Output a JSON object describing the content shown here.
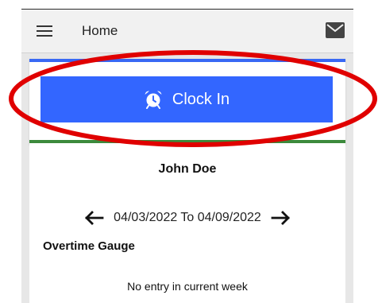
{
  "header": {
    "title": "Home",
    "menu_icon": "menu-icon",
    "mail_icon": "mail-icon"
  },
  "clock": {
    "button_label": "Clock In",
    "icon": "alarm-clock-icon",
    "accent": "#3366ff",
    "card_accent": "#3868f4"
  },
  "summary": {
    "name": "John Doe",
    "date_range": "04/03/2022 To 04/09/2022",
    "gauge_title": "Overtime Gauge",
    "no_entry": "No entry in current week",
    "card_accent": "#3c8a3c"
  },
  "annotation": {
    "color": "#e00000"
  }
}
